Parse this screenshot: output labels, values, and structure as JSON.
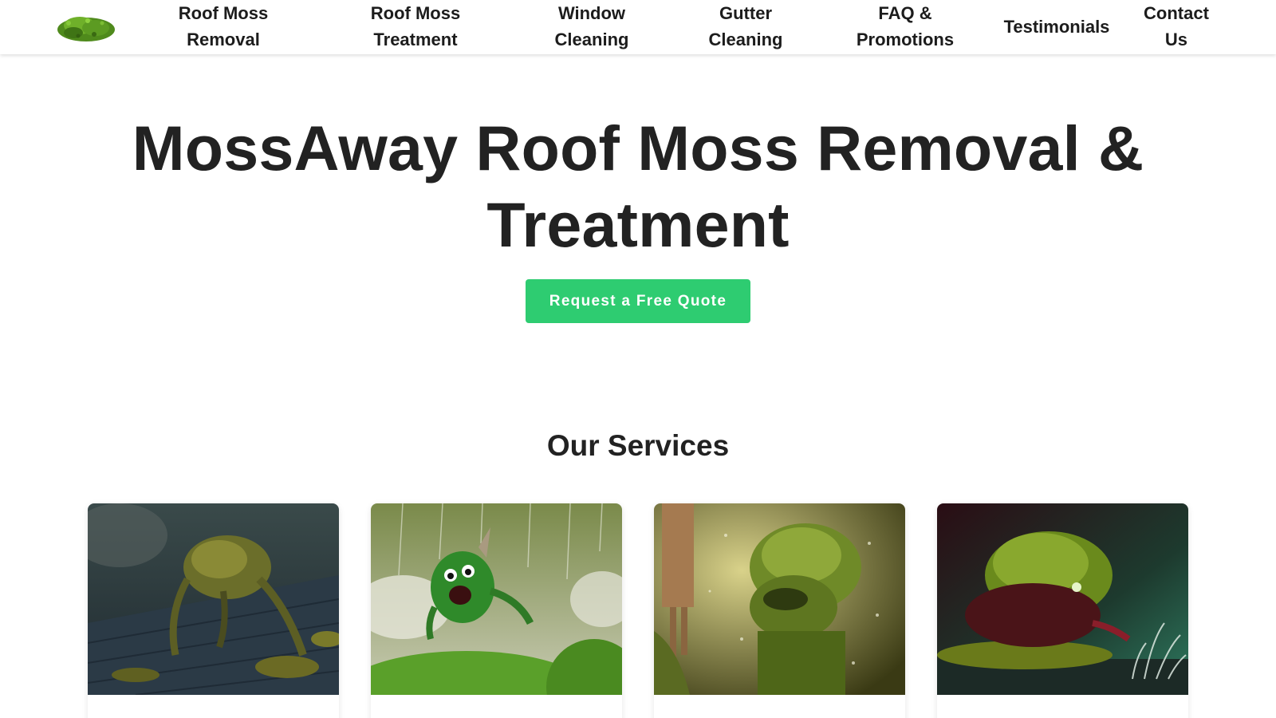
{
  "header": {
    "logo_alt": "moss-logo",
    "nav": [
      {
        "line1": "Roof Moss",
        "line2": "Removal"
      },
      {
        "line1": "Roof Moss",
        "line2": "Treatment"
      },
      {
        "line1": "Window",
        "line2": "Cleaning"
      },
      {
        "line1": "Gutter",
        "line2": "Cleaning"
      },
      {
        "line1": "FAQ &",
        "line2": "Promotions"
      },
      {
        "line1": "Testimonials",
        "line2": ""
      },
      {
        "line1": "Contact",
        "line2": "Us"
      }
    ]
  },
  "hero": {
    "title_line1": "MossAway Roof Moss Removal &",
    "title_line2": "Treatment",
    "cta_label": "Request a Free Quote"
  },
  "services": {
    "title": "Our Services",
    "cards": [
      {
        "image": "moss-creature-on-roof-shingles"
      },
      {
        "image": "moss-monster-in-rain-green-hills"
      },
      {
        "image": "moss-creature-washing-window"
      },
      {
        "image": "moss-creature-by-water-splash"
      }
    ]
  },
  "colors": {
    "accent": "#2ecc71",
    "text": "#222222",
    "background": "#ffffff"
  }
}
